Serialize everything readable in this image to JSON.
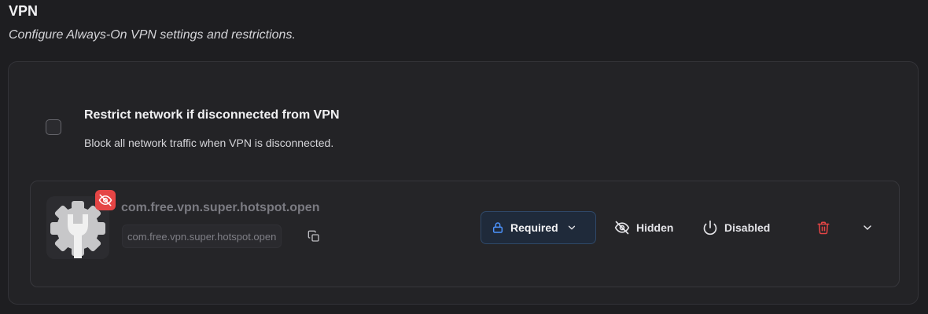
{
  "section": {
    "title": "VPN",
    "subtitle": "Configure Always-On VPN settings and restrictions."
  },
  "restrict": {
    "title": "Restrict network if disconnected from VPN",
    "description": "Block all network traffic when VPN is disconnected.",
    "checked": false
  },
  "vpn_app": {
    "name": "com.free.vpn.super.hotspot.open",
    "package": "com.free.vpn.super.hotspot.open",
    "icon": "settings-gear-wrench-icon",
    "badge_icon": "eye-off-icon",
    "mode_label": "Required",
    "mode_icon": "lock-icon",
    "visibility_label": "Hidden",
    "visibility_icon": "eye-off-icon",
    "status_label": "Disabled",
    "status_icon": "power-icon",
    "delete_icon": "trash-icon",
    "expand_icon": "chevron-down-icon"
  },
  "colors": {
    "background": "#1e1e21",
    "card": "#232326",
    "accent_blue": "#4d94ff",
    "danger_red": "#e54545",
    "muted_text": "#7b7b82"
  }
}
